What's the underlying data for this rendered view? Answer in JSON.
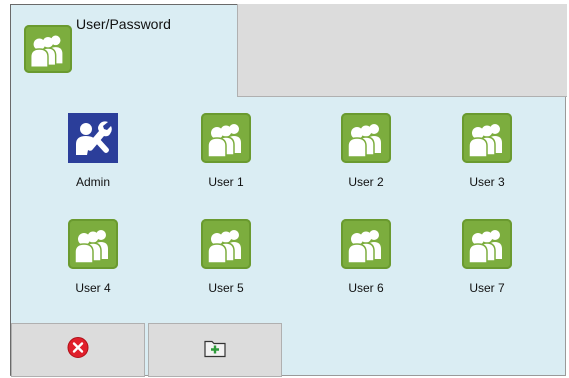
{
  "window": {
    "title": "User/Password"
  },
  "users": [
    {
      "label": "Admin",
      "icon": "admin-tools-icon"
    },
    {
      "label": "User 1",
      "icon": "users-group-icon"
    },
    {
      "label": "User 2",
      "icon": "users-group-icon"
    },
    {
      "label": "User 3",
      "icon": "users-group-icon"
    },
    {
      "label": "User 4",
      "icon": "users-group-icon"
    },
    {
      "label": "User 5",
      "icon": "users-group-icon"
    },
    {
      "label": "User 6",
      "icon": "users-group-icon"
    },
    {
      "label": "User 7",
      "icon": "users-group-icon"
    }
  ],
  "toolbar": {
    "close_icon": "close-icon",
    "add_folder_icon": "add-folder-icon"
  },
  "colors": {
    "panel_bg": "#daedf3",
    "user_icon_green": "#7cad3e",
    "admin_icon_blue": "#2b3e9a",
    "close_red": "#e0202c",
    "button_gray": "#dcdcdc"
  }
}
